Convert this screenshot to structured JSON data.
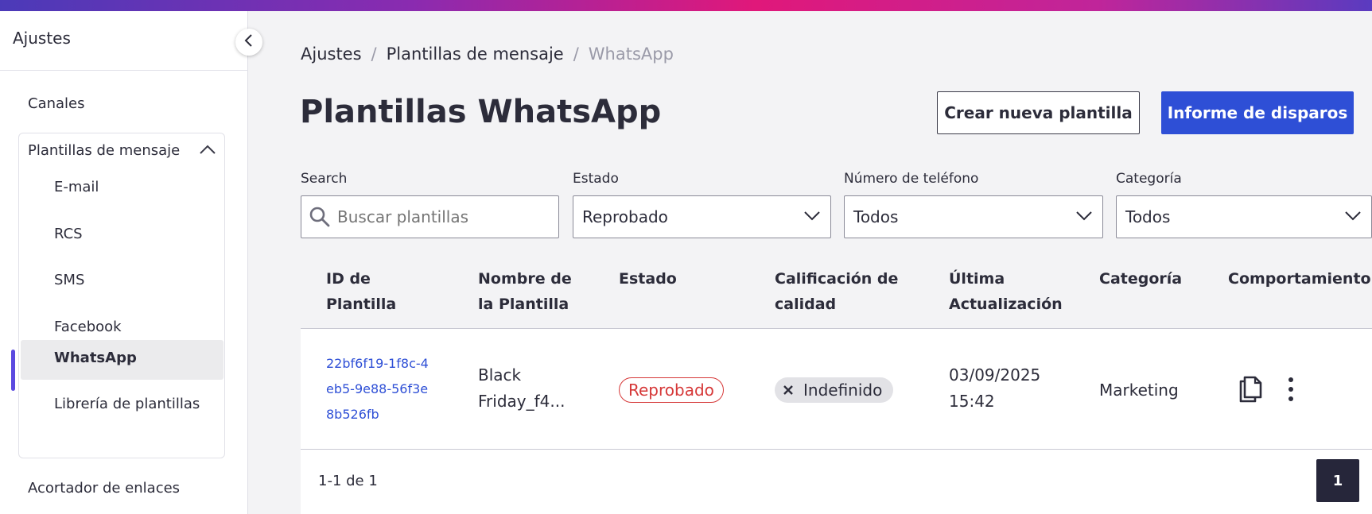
{
  "sidebar": {
    "title": "Ajustes",
    "items": [
      {
        "label": "Canales"
      },
      {
        "label": "Plantillas de mensaje"
      },
      {
        "label": "Acortador de enlaces"
      }
    ],
    "subitems": [
      {
        "label": "E-mail"
      },
      {
        "label": "RCS"
      },
      {
        "label": "SMS"
      },
      {
        "label": "Facebook"
      },
      {
        "label": "WhatsApp",
        "active": true
      },
      {
        "label": "Librería de plantillas"
      }
    ]
  },
  "breadcrumb": {
    "items": [
      "Ajustes",
      "Plantillas de mensaje",
      "WhatsApp"
    ],
    "separator": "/"
  },
  "page": {
    "title": "Plantillas WhatsApp"
  },
  "actions": {
    "create_label": "Crear nueva plantilla",
    "report_label": "Informe de disparos"
  },
  "filters": {
    "search": {
      "label": "Search",
      "placeholder": "Buscar plantillas"
    },
    "estado": {
      "label": "Estado",
      "value": "Reprobado"
    },
    "telefono": {
      "label": "Número de teléfono",
      "value": "Todos"
    },
    "categoria": {
      "label": "Categoría",
      "value": "Todos"
    }
  },
  "table": {
    "headers": {
      "id": [
        "ID de",
        "Plantilla"
      ],
      "nombre": [
        "Nombre de",
        "la Plantilla"
      ],
      "estado": [
        "Estado"
      ],
      "calidad": [
        "Calificación de",
        "calidad"
      ],
      "actualizacion": [
        "Última",
        "Actualización"
      ],
      "categoria": [
        "Categoría"
      ],
      "comportamiento": [
        "Comportamiento"
      ]
    },
    "rows": [
      {
        "id": "22bf6f19-1f8c-4eb5-9e88-56f3e8b526fb",
        "nombre": "Black Friday_f4...",
        "estado": "Reprobado",
        "calidad": "Indefinido",
        "fecha": "03/09/2025",
        "hora": "15:42",
        "categoria": "Marketing"
      }
    ]
  },
  "pagination": {
    "summary": "1-1 de 1",
    "current_page": "1"
  },
  "colors": {
    "primary": "#2e4fd6",
    "danger": "#d63838",
    "active_indicator": "#5b4ae0"
  }
}
